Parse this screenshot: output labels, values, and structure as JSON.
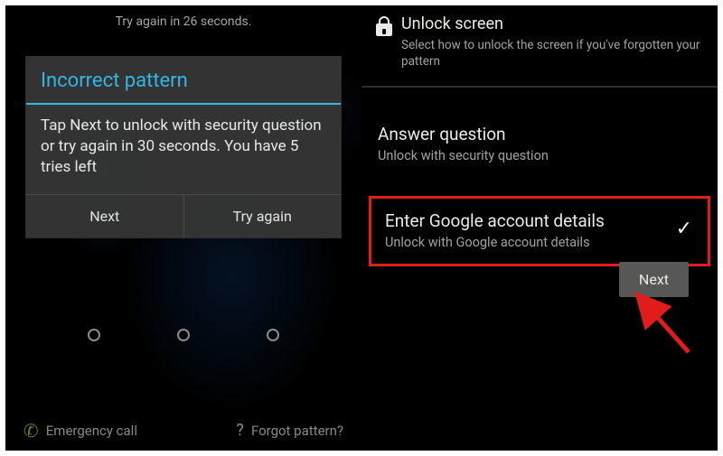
{
  "left": {
    "try_hint": "Try again in 26 seconds.",
    "dialog_title": "Incorrect pattern",
    "dialog_body": "Tap Next to unlock with security question or try again in 30 seconds. You have 5 tries left",
    "btn_next": "Next",
    "btn_try_again": "Try again",
    "emergency_label": "Emergency call",
    "forgot_label": "Forgot pattern?"
  },
  "right": {
    "header_title": "Unlock screen",
    "header_sub": "Select how to unlock the screen if you've forgotten your pattern",
    "option1_title": "Answer question",
    "option1_sub": "Unlock with security question",
    "option2_title": "Enter Google account details",
    "option2_sub": "Unlock with Google account details",
    "next_label": "Next"
  }
}
